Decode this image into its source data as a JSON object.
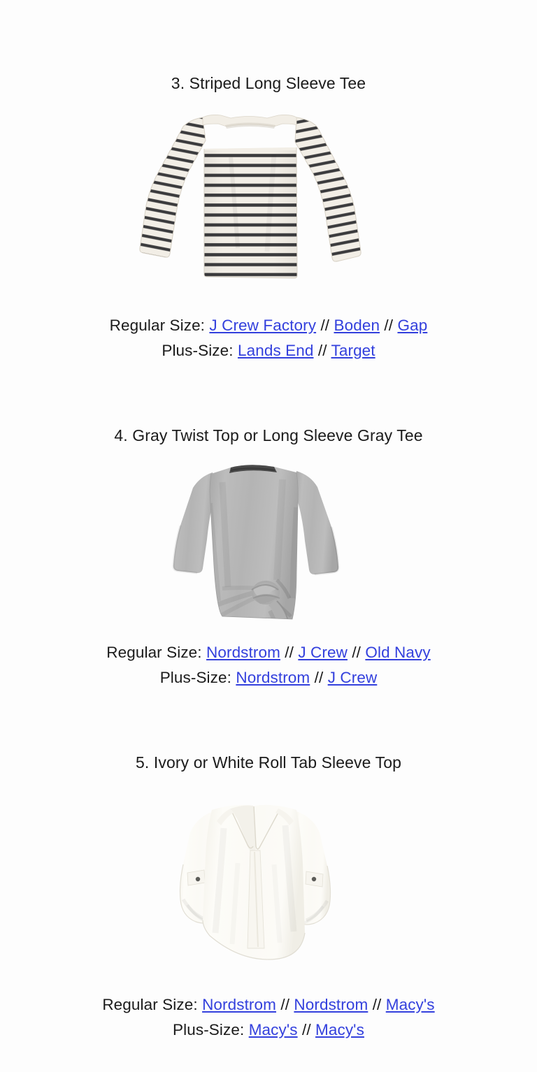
{
  "page": {
    "background_color": "#fdfdfd",
    "text_color": "#1b1b1b",
    "link_color": "#3340dd"
  },
  "separator": "//",
  "labels": {
    "regular": "Regular Size:",
    "plus": "Plus-Size:"
  },
  "sections": [
    {
      "id": "striped-long-sleeve-tee",
      "title": "3. Striped Long Sleeve Tee",
      "image": {
        "name": "striped-long-sleeve-tee-image",
        "alt": "Striped long sleeve boatneck tee",
        "base_color": "#f2eee6",
        "stripe_color": "#3b3b3d"
      },
      "regular_links": [
        "J Crew Factory",
        "Boden",
        "Gap"
      ],
      "plus_links": [
        "Lands End",
        "Target"
      ]
    },
    {
      "id": "gray-twist-top",
      "title": "4. Gray Twist Top or Long Sleeve Gray Tee",
      "image": {
        "name": "gray-twist-top-image",
        "alt": "Heather gray twist front top",
        "base_color": "#b3b3b3",
        "shadow_color": "#9a9a9a",
        "neckband_color": "#4a4a4a"
      },
      "regular_links": [
        "Nordstrom",
        "J Crew",
        "Old Navy"
      ],
      "plus_links": [
        "Nordstrom",
        "J Crew"
      ]
    },
    {
      "id": "ivory-roll-tab-sleeve-top",
      "title": "5. Ivory or White Roll Tab Sleeve Top",
      "image": {
        "name": "ivory-roll-tab-top-image",
        "alt": "Ivory roll tab sleeve V-neck top",
        "base_color": "#fbfaf6",
        "shadow_color": "#eceae2",
        "button_color": "#5c5c58"
      },
      "regular_links": [
        "Nordstrom",
        "Nordstrom",
        "Macy's"
      ],
      "plus_links": [
        "Macy's",
        "Macy's"
      ]
    }
  ]
}
